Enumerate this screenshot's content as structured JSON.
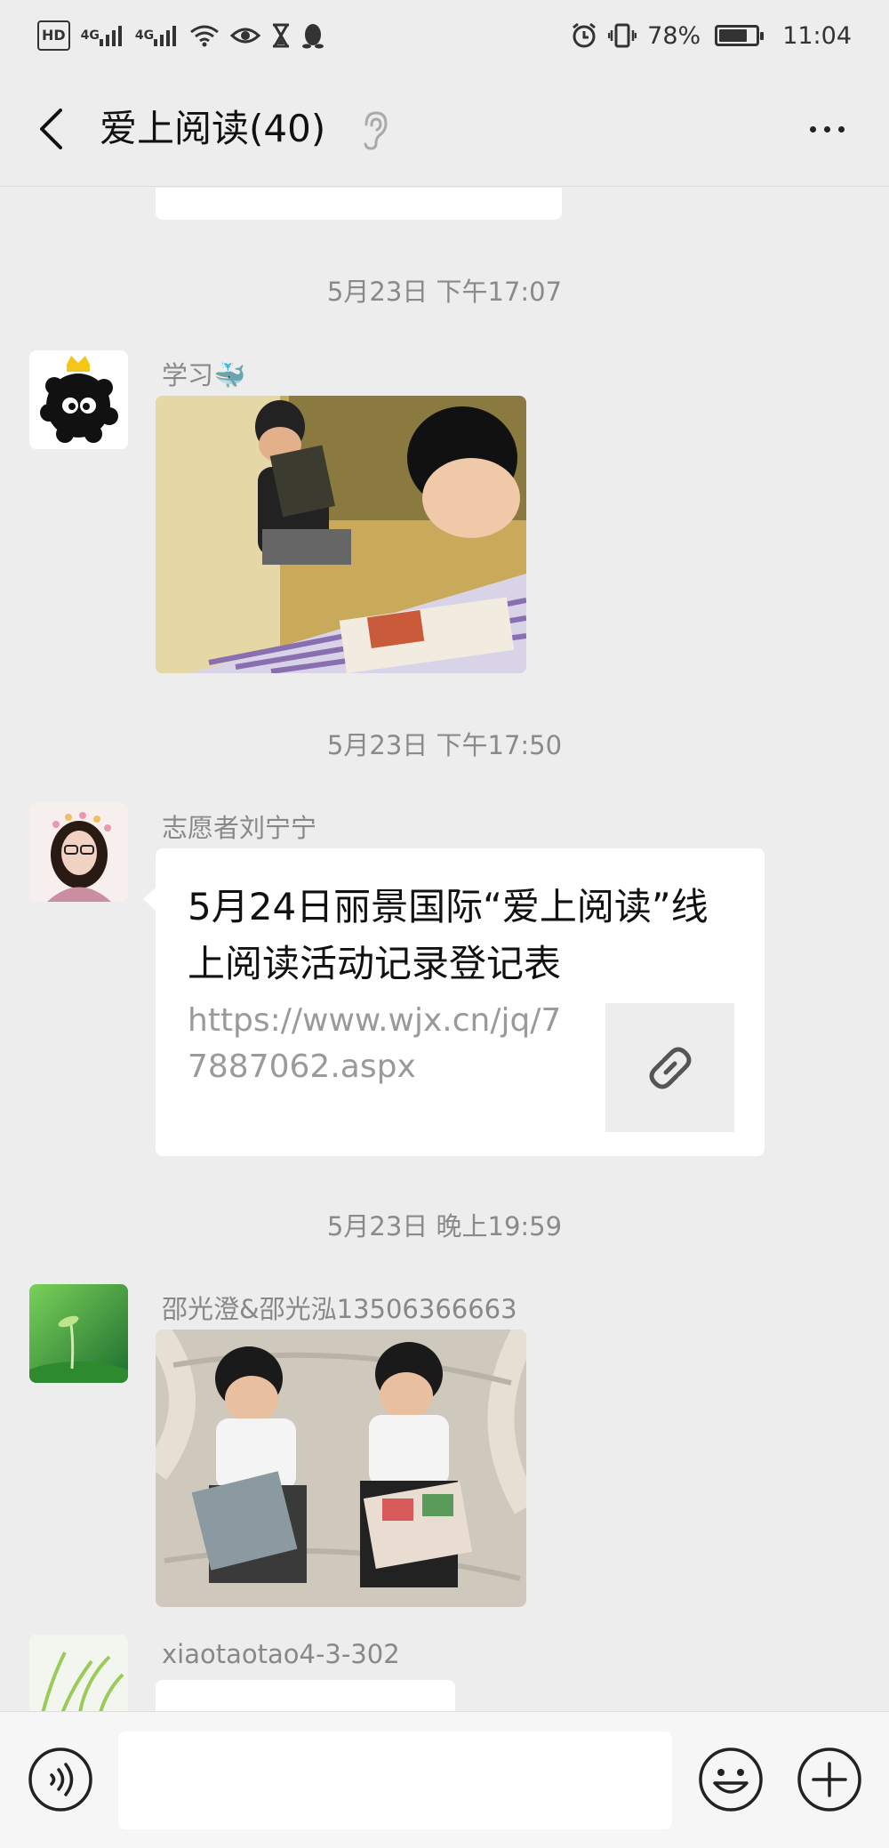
{
  "status_bar": {
    "hd_label": "HD",
    "sim1_label": "4G",
    "sim2_label": "4G",
    "battery_text": "78%",
    "battery_level": 0.78,
    "time": "11:04"
  },
  "nav": {
    "title": "爱上阅读(40)"
  },
  "messages": [
    {
      "timestamp": "5月23日 下午17:07",
      "sender": "学习🐳",
      "type": "image"
    },
    {
      "timestamp": "5月23日 下午17:50",
      "sender": "志愿者刘宁宁",
      "type": "link",
      "link_title": "5月24日丽景国际“爱上阅读”线上阅读活动记录登记表",
      "link_url": "https://www.wjx.cn/jq/77887062.aspx"
    },
    {
      "timestamp": "5月23日 晚上19:59",
      "sender": "邵光澄&邵光泓13506366663",
      "type": "image"
    },
    {
      "sender": "xiaotaotao4-3-302",
      "type": "text"
    }
  ],
  "input": {
    "placeholder": ""
  },
  "icons": {
    "back": "chevron-left-icon",
    "ear": "ear-icon",
    "more": "more-dots-icon",
    "voice": "voice-icon",
    "emoji": "emoji-icon",
    "plus": "plus-icon",
    "link": "link-icon"
  },
  "colors": {
    "background": "#ededed",
    "bubble": "#ffffff",
    "timestamp": "#8a8a8a",
    "sender": "#888888"
  }
}
